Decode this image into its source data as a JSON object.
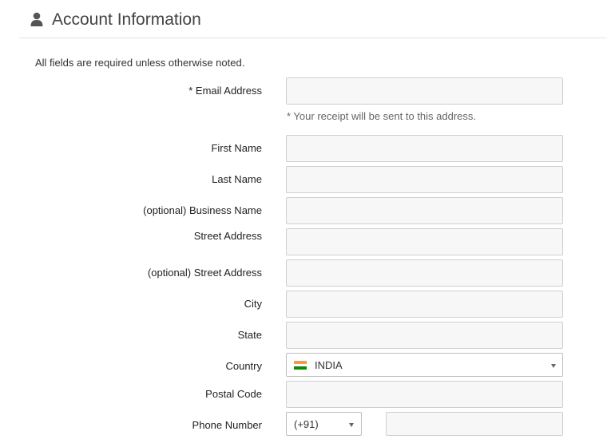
{
  "header": {
    "icon": "user-icon",
    "title": "Account Information"
  },
  "form": {
    "note": "All fields are required unless otherwise noted.",
    "email": {
      "label": "* Email Address",
      "value": "",
      "hint": "* Your receipt will be sent to this address."
    },
    "first_name": {
      "label": "First Name",
      "value": ""
    },
    "last_name": {
      "label": "Last Name",
      "value": ""
    },
    "business_name": {
      "label": "(optional) Business Name",
      "value": ""
    },
    "street_address": {
      "label": "Street Address",
      "value": ""
    },
    "street_address_2": {
      "label": "(optional) Street Address",
      "value": ""
    },
    "city": {
      "label": "City",
      "value": ""
    },
    "state": {
      "label": "State",
      "value": ""
    },
    "country": {
      "label": "Country",
      "selected": "INDIA",
      "flag_icon": "india-flag-icon"
    },
    "postal_code": {
      "label": "Postal Code",
      "value": ""
    },
    "phone": {
      "label": "Phone Number",
      "country_code": "(+91)",
      "value": ""
    }
  },
  "colors": {
    "field_bg": "#f7f7f7",
    "field_border": "#cfcfcf",
    "divider": "#e3e3e3",
    "icon": "#555555"
  }
}
